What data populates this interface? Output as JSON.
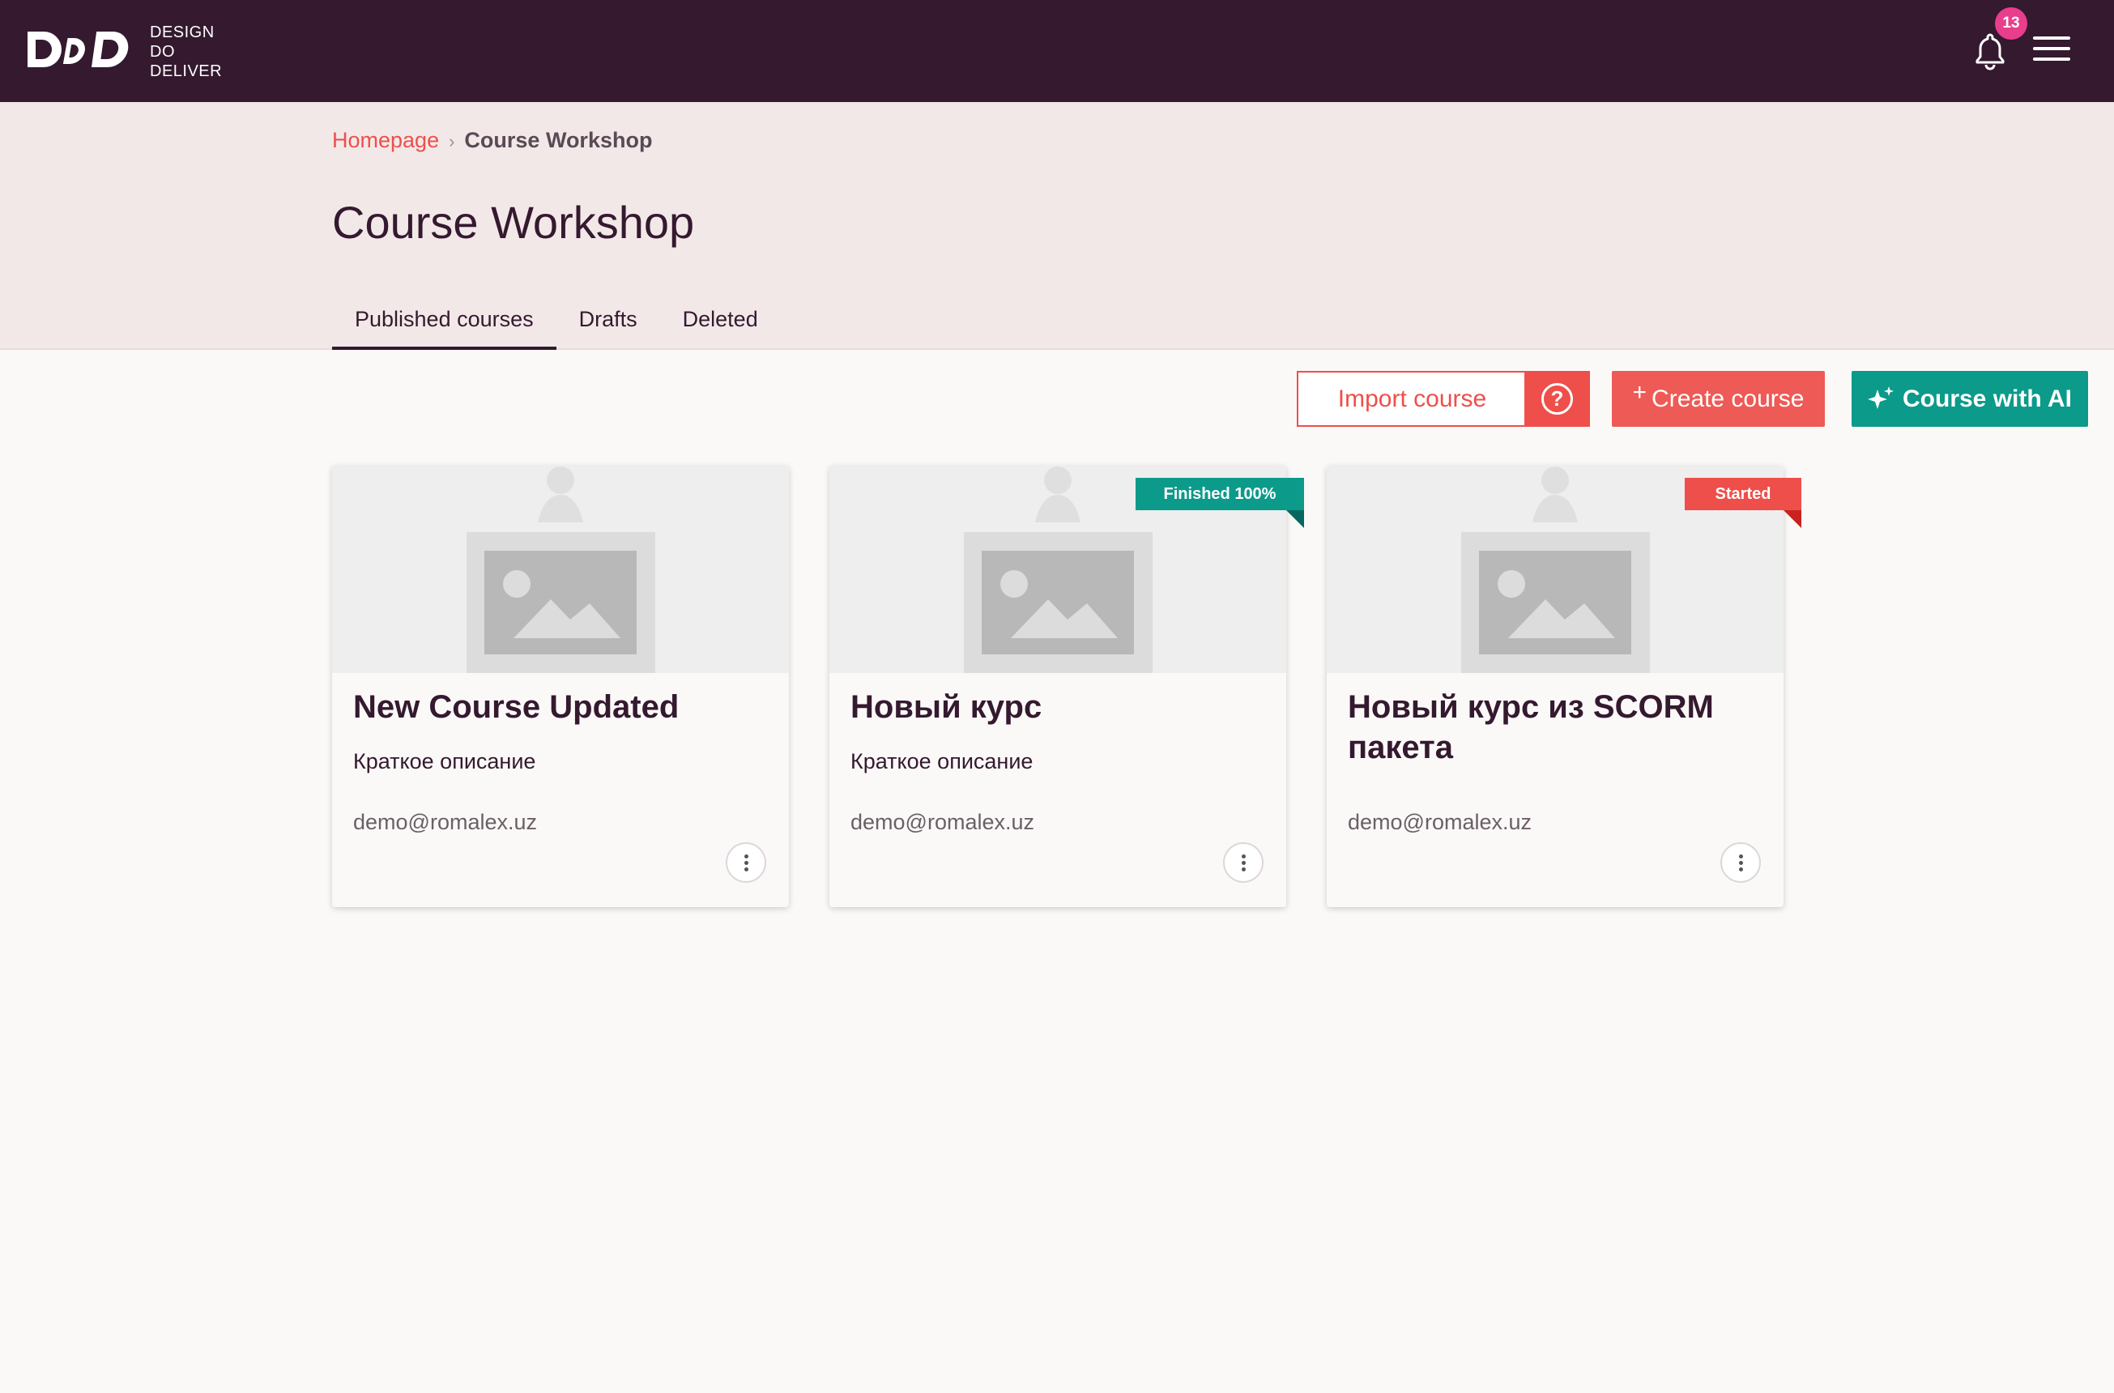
{
  "app": {
    "logo_letters": "DDD",
    "logo_lines": [
      "DESIGN",
      "DO",
      "DELIVER"
    ],
    "notifications_count": "13"
  },
  "breadcrumb": {
    "home": "Homepage",
    "separator": "›",
    "current": "Course Workshop"
  },
  "page": {
    "title": "Course Workshop"
  },
  "tabs": [
    {
      "label": "Published courses",
      "active": true
    },
    {
      "label": "Drafts",
      "active": false
    },
    {
      "label": "Deleted",
      "active": false
    }
  ],
  "actions": {
    "import_label": "Import course",
    "help_symbol": "?",
    "create_plus": "+",
    "create_label": "Create course",
    "ai_label": "Course with AI"
  },
  "cards": [
    {
      "title": "New Course Updated",
      "description": "Краткое описание",
      "author": "demo@romalex.uz",
      "status": ""
    },
    {
      "title": "Новый курс",
      "description": "Краткое описание",
      "author": "demo@romalex.uz",
      "status": "Finished 100%"
    },
    {
      "title": "Новый курс из SCORM пакета",
      "description": "",
      "author": "demo@romalex.uz",
      "status": "Started"
    }
  ],
  "colors": {
    "topbar": "#34192F",
    "accent_red": "#EE4F4A",
    "accent_teal": "#0C9A8A",
    "badge_pink": "#E83E8C",
    "header_band": "#F3E8E8"
  },
  "icons": {
    "bell": "bell-icon",
    "menu": "hamburger-menu-icon",
    "help": "question-circle-icon",
    "ai": "sparkle-icon",
    "more": "vertical-dots-icon",
    "image_placeholder": "image-placeholder-icon"
  }
}
